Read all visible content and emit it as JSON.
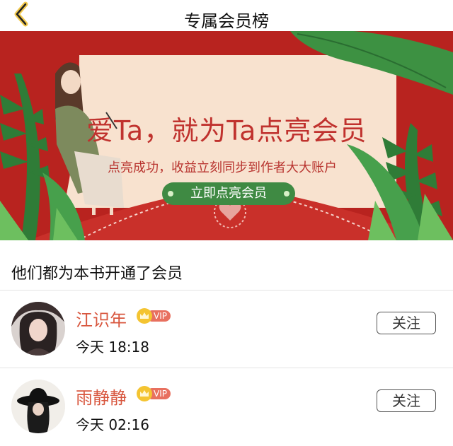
{
  "nav": {
    "title": "专属会员榜",
    "back_icon": "chevron-left-icon"
  },
  "banner": {
    "headline": "爱Ta，就为Ta点亮会员",
    "subline": "点亮成功，收益立刻同步到作者大大账户",
    "cta_label": "立即点亮会员",
    "colors": {
      "background": "#b8231f",
      "card": "#f8e2cf",
      "button": "#3f8a43"
    }
  },
  "section": {
    "title": "他们都为本书开通了会员"
  },
  "members": [
    {
      "name": "江识年",
      "badge": "VIP",
      "time": "今天 18:18",
      "follow_label": "关注"
    },
    {
      "name": "雨静静",
      "badge": "VIP",
      "time": "今天 02:16",
      "follow_label": "关注"
    }
  ],
  "colors": {
    "accent": "#d8573f",
    "vip_tag": "#e8705f",
    "crown": "#f4c431"
  }
}
